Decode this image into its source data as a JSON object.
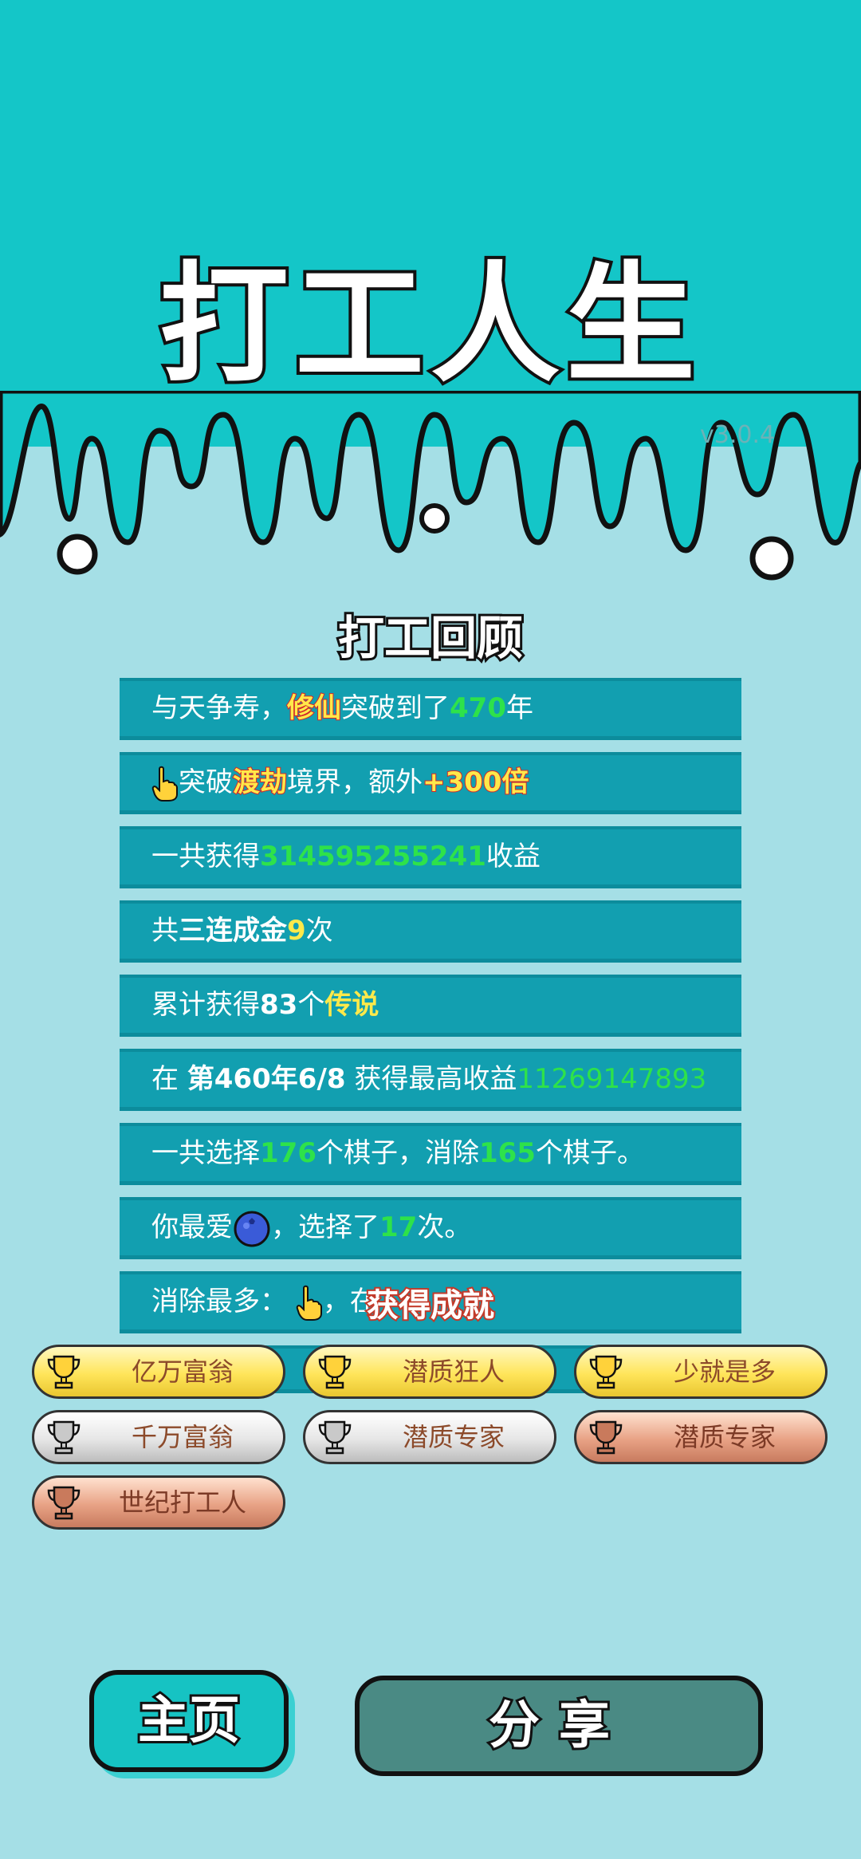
{
  "header": {
    "title": "打工人生",
    "version": "v3.0.4"
  },
  "review": {
    "title": "打工回顾",
    "rows": [
      {
        "p1": "与天争寿，",
        "hl": "修仙",
        "p2": "突破到了",
        "num": "470",
        "p3": "年"
      },
      {
        "p1": "突破",
        "hl": "渡劫",
        "p2": "境界，额外",
        "bonus": "+300倍"
      },
      {
        "p1": "一共获得",
        "num": "314595255241",
        "p2": "收益"
      },
      {
        "p1": "共",
        "bold": "三连成金",
        "num": "9",
        "p2": "次"
      },
      {
        "p1": "累计获得",
        "num": "83",
        "p2": "个",
        "hl": "传说"
      },
      {
        "p1": "在 ",
        "bold": "第460年6/8",
        "p2": " 获得最高收益",
        "num": "11269147893"
      },
      {
        "p1": "一共选择",
        "num": "176",
        "p2": "个棋子，消除",
        "num2": "165",
        "p3": "个棋子。"
      },
      {
        "p1": "你最爱",
        "p2": "，选择了",
        "num": "17",
        "p3": "次。"
      },
      {
        "p1": "消除最多：",
        "p2": "，在"
      }
    ],
    "overlay": "获得成就"
  },
  "achievements": [
    {
      "label": "亿万富翁",
      "tier": "gold"
    },
    {
      "label": "潜质狂人",
      "tier": "gold"
    },
    {
      "label": "少就是多",
      "tier": "gold"
    },
    {
      "label": "千万富翁",
      "tier": "silver"
    },
    {
      "label": "潜质专家",
      "tier": "silver"
    },
    {
      "label": "潜质专家",
      "tier": "bronze"
    },
    {
      "label": "世纪打工人",
      "tier": "bronze"
    }
  ],
  "buttons": {
    "home": "主页",
    "share": "分享"
  },
  "colors": {
    "top": "#14c6c8",
    "bg": "#a5dfe6",
    "row": "#129fb0",
    "green": "#2ee24a",
    "yellow": "#ffe94a"
  }
}
